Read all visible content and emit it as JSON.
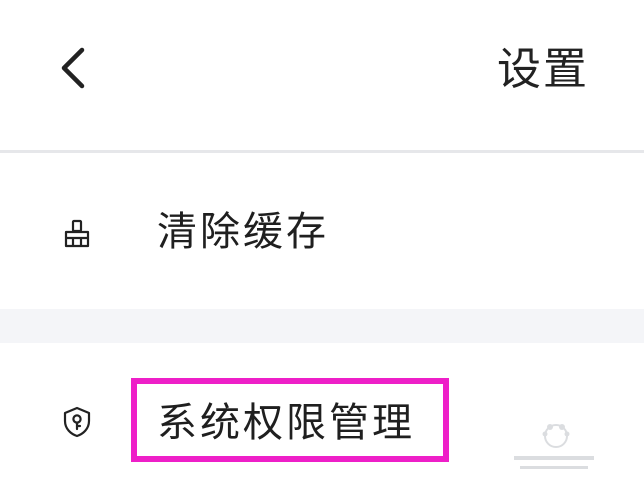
{
  "header": {
    "title": "设置",
    "back_icon": "chevron-left-icon"
  },
  "settings": {
    "items": [
      {
        "label": "清除缓存",
        "icon": "broom-icon"
      },
      {
        "label": "系统权限管理",
        "icon": "shield-key-icon"
      }
    ]
  },
  "annotation": {
    "highlight_color": "#ee1fc8"
  },
  "colors": {
    "background": "#ffffff",
    "section_gap": "#f4f5f8",
    "divider": "#e6e7ea",
    "text": "#222222"
  }
}
